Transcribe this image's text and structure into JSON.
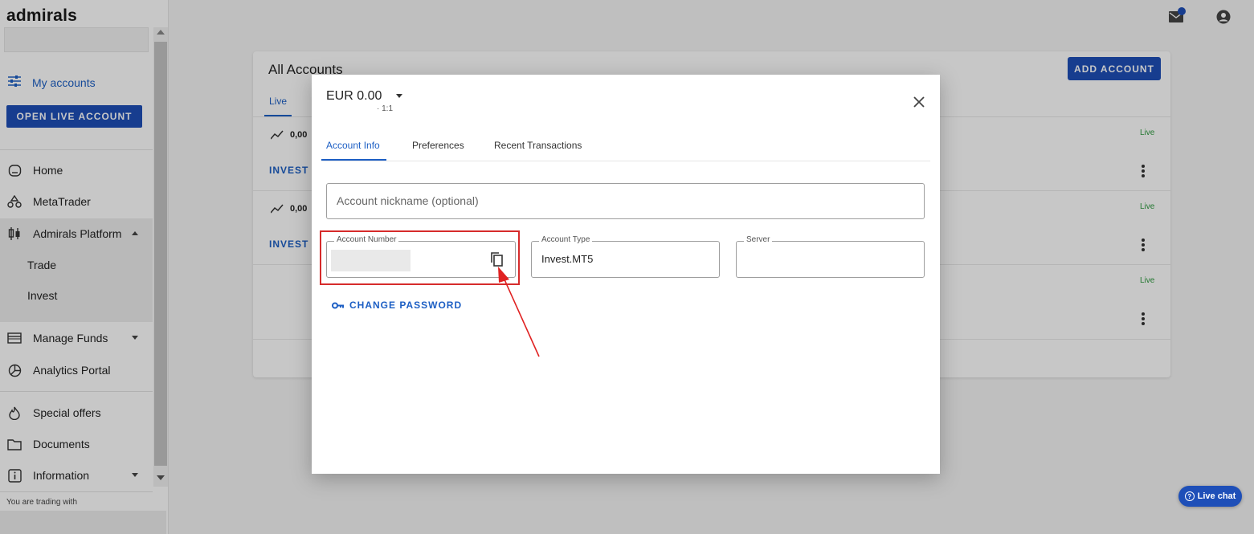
{
  "app": {
    "logo": "admirals"
  },
  "sidebar": {
    "my_accounts": "My accounts",
    "open_live_account": "OPEN LIVE ACCOUNT",
    "items": [
      {
        "label": "Home",
        "icon": "home-icon"
      },
      {
        "label": "MetaTrader",
        "icon": "metatrader-icon"
      },
      {
        "label": "Admirals Platform",
        "icon": "candlestick-icon",
        "expanded": true,
        "children": [
          {
            "label": "Trade"
          },
          {
            "label": "Invest"
          }
        ]
      },
      {
        "label": "Manage Funds",
        "icon": "wallet-icon",
        "expanded": false
      },
      {
        "label": "Analytics Portal",
        "icon": "pie-chart-icon"
      },
      {
        "label": "Special offers",
        "icon": "flame-icon"
      },
      {
        "label": "Documents",
        "icon": "folder-icon"
      },
      {
        "label": "Information",
        "icon": "info-icon",
        "expanded": false
      }
    ],
    "footer_text": "You are trading with"
  },
  "header": {
    "mail_icon": "mail-icon",
    "user_icon": "user-account-icon",
    "notification_badge_color": "#1e4fb8"
  },
  "accounts_card": {
    "title": "All Accounts",
    "add_account": "ADD ACCOUNT",
    "tab": "Live",
    "rows": [
      {
        "balance": "0,00",
        "type": "INVEST",
        "status": "Live"
      },
      {
        "balance": "0,00",
        "type": "INVEST",
        "status": "Live"
      },
      {
        "balance": "",
        "type": "",
        "status": "Live"
      }
    ]
  },
  "dialog": {
    "currency": "EUR 0.00",
    "leverage": "· 1:1",
    "tabs": [
      "Account Info",
      "Preferences",
      "Recent Transactions"
    ],
    "active_tab": "Account Info",
    "nickname_placeholder": "Account nickname (optional)",
    "account_number_label": "Account Number",
    "account_type_label": "Account Type",
    "account_type_value": "Invest.MT5",
    "server_label": "Server",
    "server_value": "",
    "change_password": "CHANGE PASSWORD"
  },
  "live_chat": {
    "label": "Live chat"
  },
  "colors": {
    "accent": "#1e4fb8",
    "link": "#1d5fc4",
    "highlight": "#d62b2b",
    "status_live": "#2e9a3f"
  }
}
